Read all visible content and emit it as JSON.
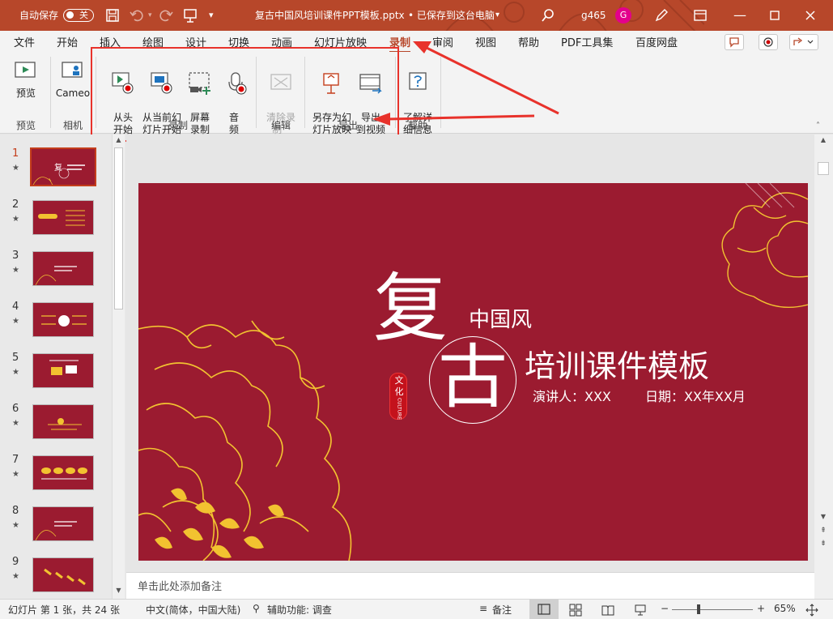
{
  "titlebar": {
    "autosave_label": "自动保存",
    "autosave_state": "关",
    "doc_title": "复古中国风培训课件PPT模板.pptx",
    "save_status": "• 已保存到这台电脑",
    "user_name": "g465",
    "avatar_letter": "G"
  },
  "menu": {
    "tabs": [
      "文件",
      "开始",
      "插入",
      "绘图",
      "设计",
      "切换",
      "动画",
      "幻灯片放映",
      "录制",
      "审阅",
      "视图",
      "帮助",
      "PDF工具集",
      "百度网盘"
    ],
    "active_tab": "录制"
  },
  "ribbon": {
    "preview": {
      "label": "预览",
      "group": "预览"
    },
    "camera": {
      "label": "Cameo",
      "group": "相机"
    },
    "record_group": "录制",
    "record_from_start": "从头\n开始",
    "record_from_current": "从当前幻\n灯片开始",
    "screen_record": "屏幕\n录制",
    "audio": "音\n频",
    "edit_group": "编辑",
    "clear_recording": "清除录\n制 ˅",
    "export_group": "导出",
    "save_as_show": "另存为幻\n灯片放映",
    "export_video": "导出\n到视频",
    "help_group": "帮助",
    "learn_more": "了解详\n细信息"
  },
  "slides": [
    {
      "num": "1",
      "star": "★"
    },
    {
      "num": "2",
      "star": "★"
    },
    {
      "num": "3",
      "star": "★"
    },
    {
      "num": "4",
      "star": "★"
    },
    {
      "num": "5",
      "star": "★"
    },
    {
      "num": "6",
      "star": "★"
    },
    {
      "num": "7",
      "star": "★"
    },
    {
      "num": "8",
      "star": "★"
    },
    {
      "num": "9",
      "star": "★"
    }
  ],
  "slide_main": {
    "char_fu": "复",
    "char_gu": "古",
    "subtitle1": "中国风",
    "subtitle2": "培训课件模板",
    "presenter": "演讲人：XXX",
    "date": "日期：XX年XX月",
    "seal_text": "文化",
    "seal_sub": "CULTURE"
  },
  "notes_placeholder": "单击此处添加备注",
  "status": {
    "slide_info": "幻灯片 第 1 张，共 24 张",
    "language": "中文(简体，中国大陆)",
    "accessibility": "辅助功能: 调查",
    "notes_label": "备注",
    "zoom_minus": "−",
    "zoom_plus": "+",
    "zoom": "65%"
  },
  "colors": {
    "accent": "#b7472a",
    "slide_bg": "#9b1b30",
    "gold": "#f2c230",
    "annotation_red": "#e8322b"
  }
}
